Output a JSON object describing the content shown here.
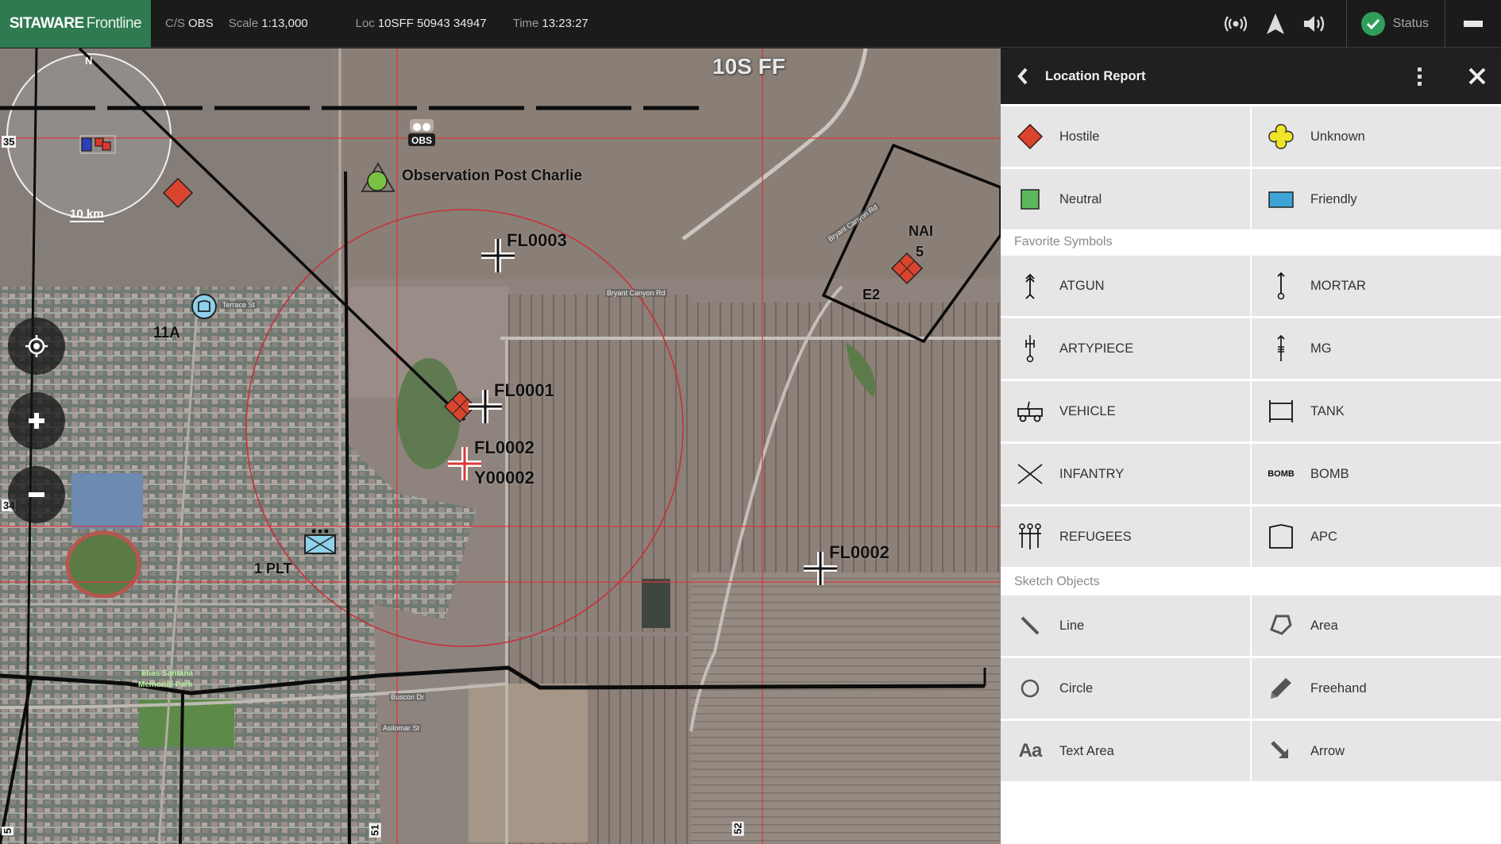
{
  "topbar": {
    "brand_bold": "SITAWARE",
    "brand_light": "Frontline",
    "fields": [
      {
        "label": "C/S",
        "value": "OBS"
      },
      {
        "label": "Scale",
        "value": "1:13,000"
      },
      {
        "label": "Loc",
        "value": "10SFF 50943 34947"
      },
      {
        "label": "Time",
        "value": "13:23:27"
      }
    ],
    "icons": [
      "broadcast-icon",
      "navigation-arrow-icon",
      "volume-icon"
    ],
    "status_label": "Status",
    "colors": {
      "brand": "#2f7a51",
      "status_ok": "#2f9e5b"
    }
  },
  "map": {
    "grid_zone": "10S FF",
    "grid_numbers": {
      "left_top": "35",
      "left_mid": "34",
      "bottom": [
        "5",
        "51",
        "52"
      ]
    },
    "overview": {
      "north": "N",
      "scale": "10 km"
    },
    "labels": {
      "obs_badge": "OBS",
      "observation_post": "Observation Post Charlie",
      "fl0003": "FL0003",
      "fl0001": "FL0001",
      "fl0002_a": "FL0002",
      "y00002": "Y00002",
      "fl0002_b": "FL0002",
      "unit_11a": "11A",
      "unit_1plt": "1 PLT",
      "nai": "NAI",
      "nai_num": "5",
      "e2": "E2"
    },
    "roads": {
      "bryant_canyon": "Bryant Canyon Rd",
      "bryant_canyon_2": "Bryant Canyon Rd",
      "terrace": "Terrace St",
      "park": [
        "Elias Santana",
        "Memorial Park"
      ],
      "buscon": "Buscon Dr",
      "asilomar": "Asilomar St"
    },
    "controls": {
      "locate": "locate-icon",
      "zoom_in": "+",
      "zoom_out": "−"
    },
    "colors": {
      "hostile": "#d9442e",
      "friendly": "#8fd0ea",
      "neutral": "#7ac143",
      "grid_line": "#d9383a"
    }
  },
  "panel": {
    "title": "Location Report",
    "affiliations": [
      {
        "label": "Hostile",
        "icon": "hostile-diamond-icon",
        "color": "#d9442e"
      },
      {
        "label": "Unknown",
        "icon": "unknown-quatrefoil-icon",
        "color": "#f1e52a"
      },
      {
        "label": "Neutral",
        "icon": "neutral-square-icon",
        "color": "#5bb85b"
      },
      {
        "label": "Friendly",
        "icon": "friendly-rectangle-icon",
        "color": "#3ea4d6"
      }
    ],
    "favorites_heading": "Favorite Symbols",
    "favorites": [
      {
        "label": "ATGUN",
        "icon": "atgun-icon"
      },
      {
        "label": "MORTAR",
        "icon": "mortar-icon"
      },
      {
        "label": "ARTYPIECE",
        "icon": "artypiece-icon"
      },
      {
        "label": "MG",
        "icon": "mg-icon"
      },
      {
        "label": "VEHICLE",
        "icon": "vehicle-icon"
      },
      {
        "label": "TANK",
        "icon": "tank-icon"
      },
      {
        "label": "INFANTRY",
        "icon": "infantry-icon"
      },
      {
        "label": "BOMB",
        "icon": "bomb-icon",
        "icon_text": "BOMB"
      },
      {
        "label": "REFUGEES",
        "icon": "refugees-icon"
      },
      {
        "label": "APC",
        "icon": "apc-icon"
      }
    ],
    "sketch_heading": "Sketch Objects",
    "sketch": [
      {
        "label": "Line",
        "icon": "line-icon"
      },
      {
        "label": "Area",
        "icon": "area-icon"
      },
      {
        "label": "Circle",
        "icon": "circle-icon"
      },
      {
        "label": "Freehand",
        "icon": "pencil-icon"
      },
      {
        "label": "Text Area",
        "icon": "text-icon",
        "icon_text": "Aa"
      },
      {
        "label": "Arrow",
        "icon": "arrow-icon"
      }
    ]
  }
}
